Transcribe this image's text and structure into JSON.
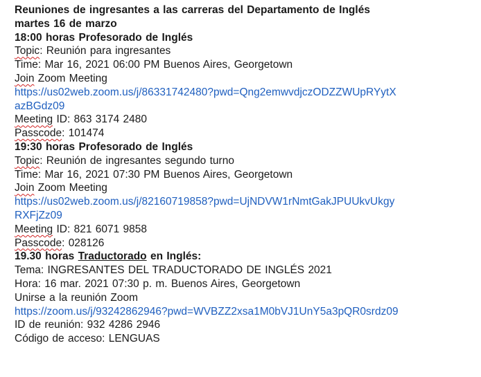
{
  "header": {
    "title_line1": "Reuniones de ingresantes a las carreras del Departamento de Inglés",
    "title_line2": "martes 16 de marzo"
  },
  "meeting1": {
    "heading": "18:00 horas Profesorado de Inglés",
    "topic_label": "Topic",
    "topic_value": ": Reunión para ingresantes",
    "time": "Time: Mar 16, 2021 06:00 PM Buenos Aires, Georgetown",
    "join_word": "Join",
    "join_rest": " Zoom Meeting",
    "link_line1": "https://us02web.zoom.us/j/86331742480?pwd=Qng2emwvdjczODZZWUpRYytX",
    "link_line2": "azBGdz09",
    "id_label": "Meeting",
    "id_rest": " ID: 863 3174 2480",
    "pass_label": "Passcode",
    "pass_rest": ": 101474"
  },
  "meeting2": {
    "heading": "19:30 horas Profesorado de Inglés",
    "topic_label": "Topic",
    "topic_value": ": Reunión de ingresantes segundo turno",
    "time": "Time: Mar 16, 2021 07:30 PM Buenos Aires, Georgetown",
    "join_word": "Join",
    "join_rest": " Zoom Meeting",
    "link_line1": "https://us02web.zoom.us/j/82160719858?pwd=UjNDVW1rNmtGakJPUUkvUkgy",
    "link_line2": "RXFjZz09",
    "id_label": "Meeting",
    "id_rest": " ID: 821 6071 9858",
    "pass_label": "Passcode",
    "pass_rest": ": 028126"
  },
  "meeting3": {
    "heading_pre": "19.30 horas ",
    "heading_under": "Traductorado",
    "heading_post": " en Inglés:",
    "tema": "Tema: INGRESANTES DEL TRADUCTORADO DE INGLÉS 2021",
    "hora": "Hora: 16 mar. 2021 07:30 p. m. Buenos Aires, Georgetown",
    "join": "Unirse a la reunión Zoom",
    "link": "https://zoom.us/j/93242862946?pwd=WVBZZ2xsa1M0bVJ1UnY5a3pQR0srdz09",
    "id": "ID de reunión: 932 4286 2946",
    "code": "Código de acceso: LENGUAS"
  },
  "colors": {
    "link": "#1f5fbf",
    "text": "#1a1a1a",
    "spellcheck": "#d02020"
  }
}
